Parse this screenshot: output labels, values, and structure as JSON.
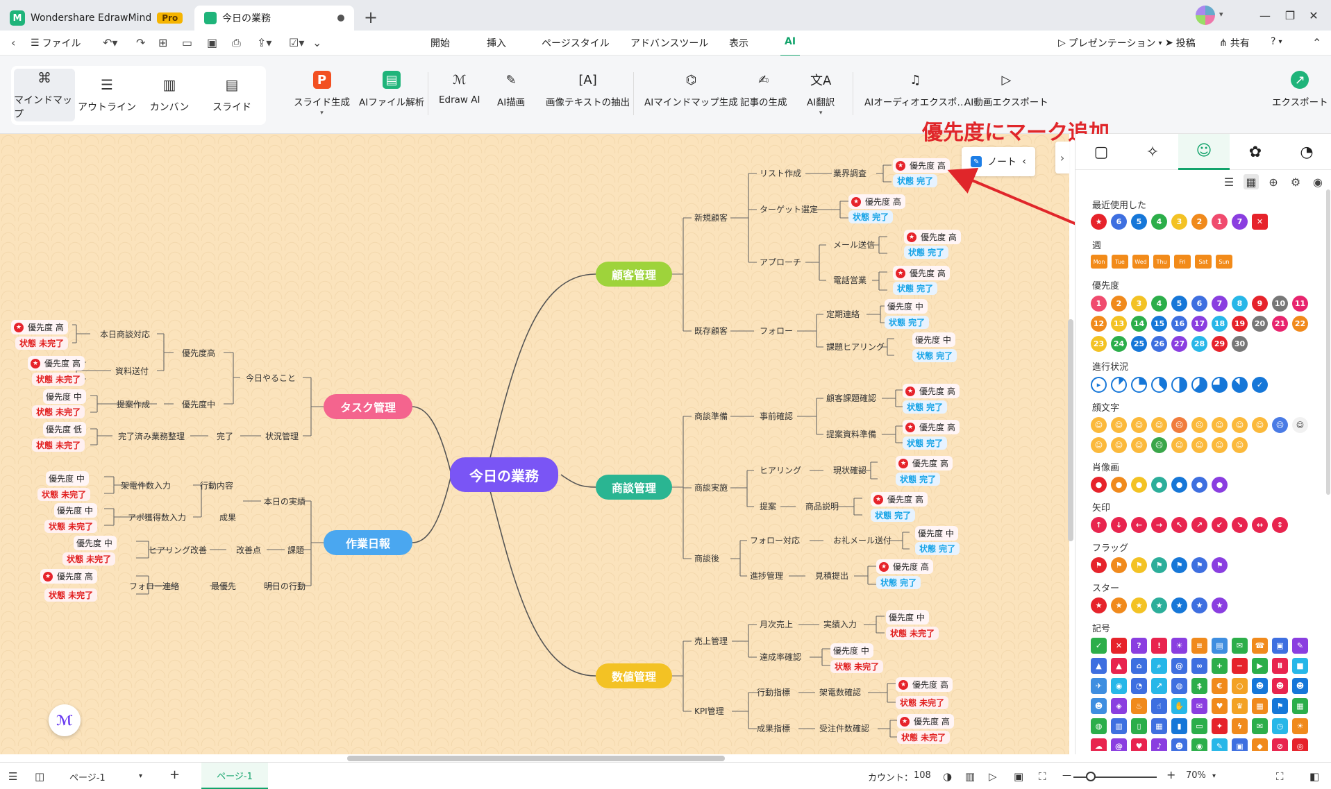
{
  "titlebar": {
    "app_name": "Wondershare EdrawMind",
    "plan_badge": "Pro",
    "doc_tab": "今日の業務"
  },
  "menubar": {
    "file": "ファイル",
    "tabs": [
      "開始",
      "挿入",
      "ページスタイル",
      "アドバンスツール",
      "表示",
      "AI"
    ],
    "active_tab": "AI",
    "presentation": "プレゼンテーション",
    "post": "投稿",
    "share": "共有"
  },
  "ribbon": {
    "views": [
      "マインドマップ",
      "アウトライン",
      "カンバン",
      "スライド"
    ],
    "active_view": "マインドマップ",
    "buttons": [
      "スライド生成",
      "AIファイル解析",
      "Edraw AI",
      "AI描画",
      "画像テキストの抽出",
      "AIマインドマップ生成",
      "記事の生成",
      "AI翻訳",
      "AIオーディオエクスポ…",
      "AI動画エクスポート"
    ],
    "export": "エクスポート"
  },
  "annotation": "優先度にマーク追加",
  "note_chip": "ノート",
  "mindmap": {
    "central": "今日の業務",
    "main": [
      "顧客管理",
      "商談管理",
      "数値管理",
      "タスク管理",
      "作業日報"
    ],
    "labels": {
      "n1": "新規顧客",
      "n2": "既存顧客",
      "n3": "リスト作成",
      "n4": "ターゲット選定",
      "n5": "アプローチ",
      "n6": "業界調査",
      "n7": "メール送信",
      "n8": "電話営業",
      "n9": "フォロー",
      "n10": "定期連絡",
      "n11": "課題ヒアリング",
      "n12": "商談準備",
      "n13": "商談実施",
      "n14": "商談後",
      "n15": "事前確認",
      "n16": "顧客課題確認",
      "n17": "提案資料準備",
      "n18": "ヒアリング",
      "n19": "現状確認",
      "n20": "提案",
      "n21": "商品説明",
      "n22": "フォロー対応",
      "n23": "お礼メール送付",
      "n24": "進捗管理",
      "n25": "見積提出",
      "n26": "売上管理",
      "n27": "KPI管理",
      "n28": "月次売上",
      "n29": "実績入力",
      "n30": "達成率確認",
      "n31": "行動指標",
      "n32": "架電数確認",
      "n33": "成果指標",
      "n34": "受注件数確認",
      "n35": "今日やること",
      "n36": "状況管理",
      "n37": "優先度高",
      "n38": "優先度中",
      "n39": "完了",
      "n40": "本日商談対応",
      "n41": "資料送付",
      "n42": "提案作成",
      "n43": "完了済み業務整理",
      "n44": "本日の実績",
      "n45": "課題",
      "n46": "明日の行動",
      "n47": "行動内容",
      "n48": "成果",
      "n49": "改善点",
      "n50": "最優先",
      "n51": "架電件数入力",
      "n52": "アポ獲得数入力",
      "n53": "ヒアリング改善",
      "n54": "フォロー連絡"
    },
    "prio_high": "優先度 高",
    "prio_mid": "優先度 中",
    "prio_low": "優先度 低",
    "status_done": "状態 完了",
    "status_todo": "状態 未完了"
  },
  "panel": {
    "sections": {
      "recent": "最近使用した",
      "week": "週",
      "priority": "優先度",
      "progress": "進行状況",
      "face": "顔文字",
      "portrait": "肖像画",
      "arrow": "矢印",
      "flag": "フラッグ",
      "star": "スター",
      "symbol": "記号"
    },
    "recent_icons": [
      "★",
      "6",
      "5",
      "4",
      "3",
      "2",
      "1",
      "7",
      "✕"
    ],
    "days": [
      "Mon",
      "Tue",
      "Wed",
      "Thu",
      "Fri",
      "Sat",
      "Sun"
    ],
    "priority_numbers": [
      "1",
      "2",
      "3",
      "4",
      "5",
      "6",
      "7",
      "8",
      "9",
      "10",
      "11",
      "12",
      "13",
      "14",
      "15",
      "16",
      "17",
      "18",
      "19",
      "20",
      "21",
      "22",
      "23",
      "24",
      "25",
      "26",
      "27",
      "28",
      "29",
      "30"
    ]
  },
  "statusbar": {
    "page_select": "ページ-1",
    "page_tab": "ページ-1",
    "count_label": "カウント：",
    "count_value": "108",
    "zoom": "70%"
  },
  "colors": {
    "accent": "#12a36b",
    "central": "#7a55f5",
    "customer": "#9ed33b",
    "deal": "#2ab592",
    "numbers": "#f3c224",
    "task": "#f4648e",
    "report": "#4aa7f0",
    "annotation": "#e0262a"
  }
}
